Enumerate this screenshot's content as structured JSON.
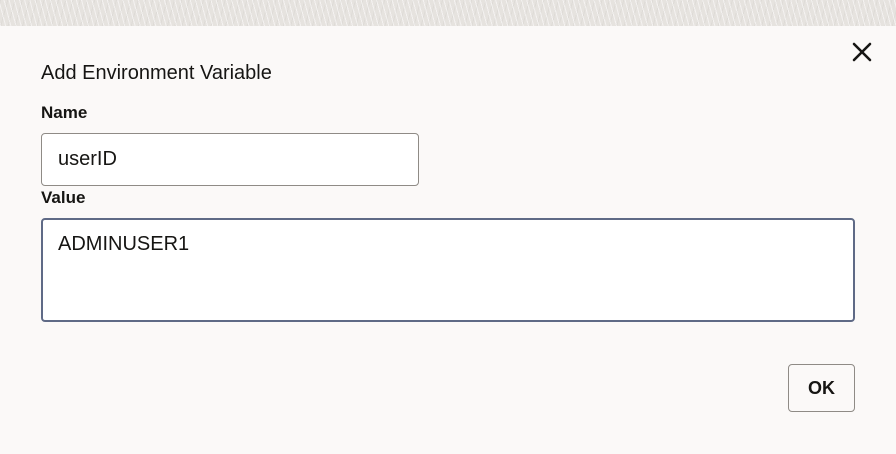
{
  "dialog": {
    "title": "Add Environment Variable",
    "close_icon": "close-icon",
    "fields": {
      "name": {
        "label": "Name",
        "value": "userID",
        "placeholder": ""
      },
      "value": {
        "label": "Value",
        "value": "ADMINUSER1",
        "placeholder": ""
      }
    },
    "ok_label": "OK"
  },
  "colors": {
    "dialog_background": "#fbf9f8",
    "text": "#161513",
    "field_border": "#8f8b86",
    "focused_border": "#5f6a86"
  }
}
